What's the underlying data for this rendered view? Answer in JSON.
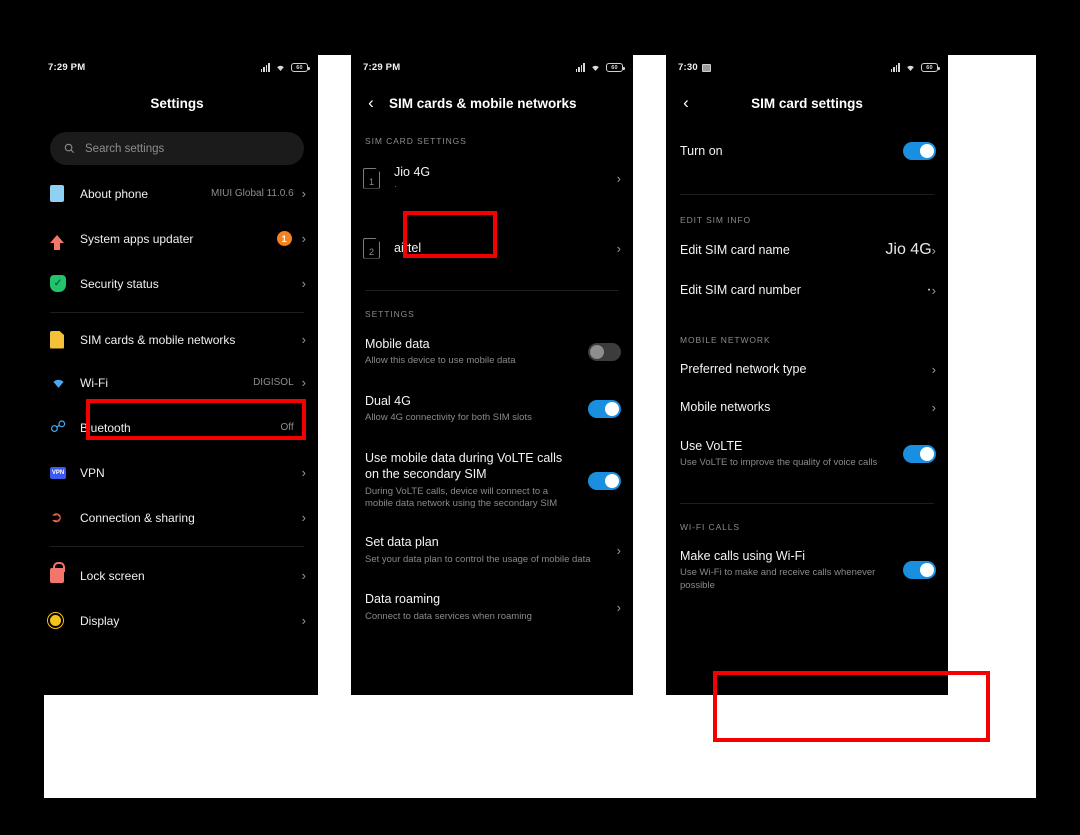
{
  "panels": {
    "settings": {
      "status": {
        "time": "7:29 PM",
        "battery": "60"
      },
      "title": "Settings",
      "search_placeholder": "Search settings",
      "items": [
        {
          "icon": "about-phone-icon",
          "label": "About phone",
          "value": "MIUI Global 11.0.6",
          "chevron": "›"
        },
        {
          "icon": "system-updater-icon",
          "label": "System apps updater",
          "badge": "1",
          "chevron": "›"
        },
        {
          "icon": "security-status-icon",
          "label": "Security status",
          "value": "",
          "chevron": "›"
        },
        {
          "icon": "sim-cards-icon",
          "label": "SIM cards & mobile networks",
          "value": "",
          "chevron": "›"
        },
        {
          "icon": "wifi-icon",
          "label": "Wi-Fi",
          "value": "DIGISOL",
          "chevron": "›"
        },
        {
          "icon": "bluetooth-icon",
          "label": "Bluetooth",
          "value": "Off",
          "chevron": "›"
        },
        {
          "icon": "vpn-icon",
          "label": "VPN",
          "value": "",
          "chevron": "›"
        },
        {
          "icon": "connection-sharing-icon",
          "label": "Connection & sharing",
          "value": "",
          "chevron": "›"
        },
        {
          "icon": "lock-screen-icon",
          "label": "Lock screen",
          "value": "",
          "chevron": "›"
        },
        {
          "icon": "display-icon",
          "label": "Display",
          "value": "",
          "chevron": "›"
        }
      ]
    },
    "sim_networks": {
      "status": {
        "time": "7:29 PM",
        "battery": "60"
      },
      "title": "SIM cards & mobile networks",
      "back": "‹",
      "section_sim": "SIM CARD SETTINGS",
      "sims": [
        {
          "slot": "1",
          "name": "Jio 4G",
          "sub": "·",
          "chevron": "›"
        },
        {
          "slot": "2",
          "name": "airtel",
          "sub": "",
          "chevron": "›"
        }
      ],
      "section_settings": "SETTINGS",
      "settings": [
        {
          "title": "Mobile data",
          "sub": "Allow this device to use mobile data",
          "control": "toggle",
          "on": false
        },
        {
          "title": "Dual 4G",
          "sub": "Allow 4G connectivity for both SIM slots",
          "control": "toggle",
          "on": true
        },
        {
          "title": "Use mobile data during VoLTE calls on the secondary SIM",
          "sub": "During VoLTE calls, device will connect to a mobile data network using the secondary SIM",
          "control": "toggle",
          "on": true
        },
        {
          "title": "Set data plan",
          "sub": "Set your data plan to control the usage of mobile data",
          "control": "chevron",
          "chevron": "›"
        },
        {
          "title": "Data roaming",
          "sub": "Connect to data services when roaming",
          "control": "chevron",
          "chevron": "›"
        }
      ]
    },
    "sim_card_settings": {
      "status": {
        "time": "7:30",
        "battery": "60",
        "has_mail_icon": true
      },
      "title": "SIM card settings",
      "back": "‹",
      "turn_on": {
        "title": "Turn on",
        "on": true
      },
      "section_edit": "EDIT SIM INFO",
      "edit_items": [
        {
          "title": "Edit SIM card name",
          "value": "Jio 4G",
          "chevron": "›"
        },
        {
          "title": "Edit SIM card number",
          "value": "·",
          "chevron": "›"
        }
      ],
      "section_mobile": "MOBILE NETWORK",
      "mobile_items": [
        {
          "title": "Preferred network type",
          "sub": "",
          "control": "chevron",
          "chevron": "›"
        },
        {
          "title": "Mobile networks",
          "sub": "",
          "control": "chevron",
          "chevron": "›"
        },
        {
          "title": "Use VoLTE",
          "sub": "Use VoLTE to improve the quality of voice calls",
          "control": "toggle",
          "on": true
        }
      ],
      "section_wifi_calls": "WI-FI CALLS",
      "wifi_call": {
        "title": "Make calls using Wi-Fi",
        "sub": "Use Wi-Fi to make and receive calls whenever possible",
        "on": true
      }
    }
  },
  "highlights": {
    "color": "#f40000",
    "boxes": [
      {
        "name": "highlight-sim-cards-row"
      },
      {
        "name": "highlight-jio-sim-row"
      },
      {
        "name": "highlight-make-calls-using-wifi"
      }
    ]
  }
}
